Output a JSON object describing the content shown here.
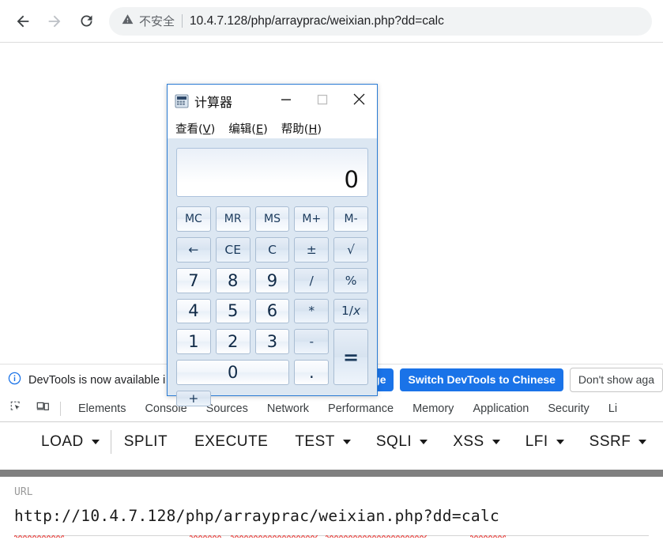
{
  "browser": {
    "back_icon": "arrow-left-icon",
    "forward_icon": "arrow-right-icon",
    "reload_icon": "reload-icon",
    "security_icon": "warning-triangle-icon",
    "security_label": "不安全",
    "url": "10.4.7.128/php/arrayprac/weixian.php?dd=calc"
  },
  "calculator": {
    "title": "计算器",
    "app_icon": "calculator-icon",
    "minimize_label": "—",
    "maximize_label": "□",
    "close_label": "✕",
    "menu": [
      {
        "text": "查看",
        "accel": "V"
      },
      {
        "text": "编辑",
        "accel": "E"
      },
      {
        "text": "帮助",
        "accel": "H"
      }
    ],
    "display_value": "0",
    "keys": [
      {
        "label": "MC",
        "name": "memory-clear",
        "class": "mem"
      },
      {
        "label": "MR",
        "name": "memory-recall",
        "class": "mem"
      },
      {
        "label": "MS",
        "name": "memory-store",
        "class": "mem"
      },
      {
        "label": "M+",
        "name": "memory-add",
        "class": "mem"
      },
      {
        "label": "M-",
        "name": "memory-subtract",
        "class": "mem"
      },
      {
        "label": "←",
        "name": "backspace",
        "class": "op"
      },
      {
        "label": "CE",
        "name": "clear-entry",
        "class": "op"
      },
      {
        "label": "C",
        "name": "clear",
        "class": "op"
      },
      {
        "label": "±",
        "name": "plus-minus",
        "class": "op"
      },
      {
        "label": "√",
        "name": "square-root",
        "class": "op"
      },
      {
        "label": "7",
        "name": "digit-7",
        "class": "num"
      },
      {
        "label": "8",
        "name": "digit-8",
        "class": "num"
      },
      {
        "label": "9",
        "name": "digit-9",
        "class": "num"
      },
      {
        "label": "/",
        "name": "divide",
        "class": "op"
      },
      {
        "label": "%",
        "name": "percent",
        "class": "op"
      },
      {
        "label": "4",
        "name": "digit-4",
        "class": "num"
      },
      {
        "label": "5",
        "name": "digit-5",
        "class": "num"
      },
      {
        "label": "6",
        "name": "digit-6",
        "class": "num"
      },
      {
        "label": "*",
        "name": "multiply",
        "class": "op"
      },
      {
        "label": "1/x",
        "name": "reciprocal",
        "class": "op"
      },
      {
        "label": "1",
        "name": "digit-1",
        "class": "num"
      },
      {
        "label": "2",
        "name": "digit-2",
        "class": "num"
      },
      {
        "label": "3",
        "name": "digit-3",
        "class": "num"
      },
      {
        "label": "-",
        "name": "subtract",
        "class": "op"
      },
      {
        "label": "=",
        "name": "equals",
        "class": "op eq"
      },
      {
        "label": "0",
        "name": "digit-0",
        "class": "num zero"
      },
      {
        "label": ".",
        "name": "decimal-point",
        "class": "num"
      },
      {
        "label": "+",
        "name": "add",
        "class": "op"
      }
    ]
  },
  "devtools_banner": {
    "info_icon": "info-circle-icon",
    "message": "DevTools is now available i",
    "match_language_label": "guage",
    "switch_label": "Switch DevTools to Chinese",
    "dismiss_label": "Don't show aga"
  },
  "devtools_tabs": {
    "inspect_icon": "inspect-element-icon",
    "device_icon": "device-toolbar-icon",
    "items": [
      "Elements",
      "Console",
      "Sources",
      "Network",
      "Performance",
      "Memory",
      "Application",
      "Security",
      "Li"
    ]
  },
  "hackbar": {
    "items": [
      {
        "label": "LOAD",
        "caret": true,
        "sep_after": true
      },
      {
        "label": "SPLIT",
        "caret": false,
        "sep_after": false
      },
      {
        "label": "EXECUTE",
        "caret": false,
        "sep_after": false
      },
      {
        "label": "TEST",
        "caret": true,
        "sep_after": false
      },
      {
        "label": "SQLI",
        "caret": true,
        "sep_after": false
      },
      {
        "label": "XSS",
        "caret": true,
        "sep_after": false
      },
      {
        "label": "LFI",
        "caret": true,
        "sep_after": false
      },
      {
        "label": "SSRF",
        "caret": true,
        "sep_after": false
      }
    ]
  },
  "url_field": {
    "label": "URL",
    "value": "http://10.4.7.128/php/arrayprac/weixian.php?dd=calc"
  },
  "colors": {
    "accent_blue": "#1a73e8",
    "window_border": "#2a7bd4",
    "window_bg": "#dce7f2",
    "grey_bar": "#808080",
    "spellcheck_red": "#e53935"
  }
}
